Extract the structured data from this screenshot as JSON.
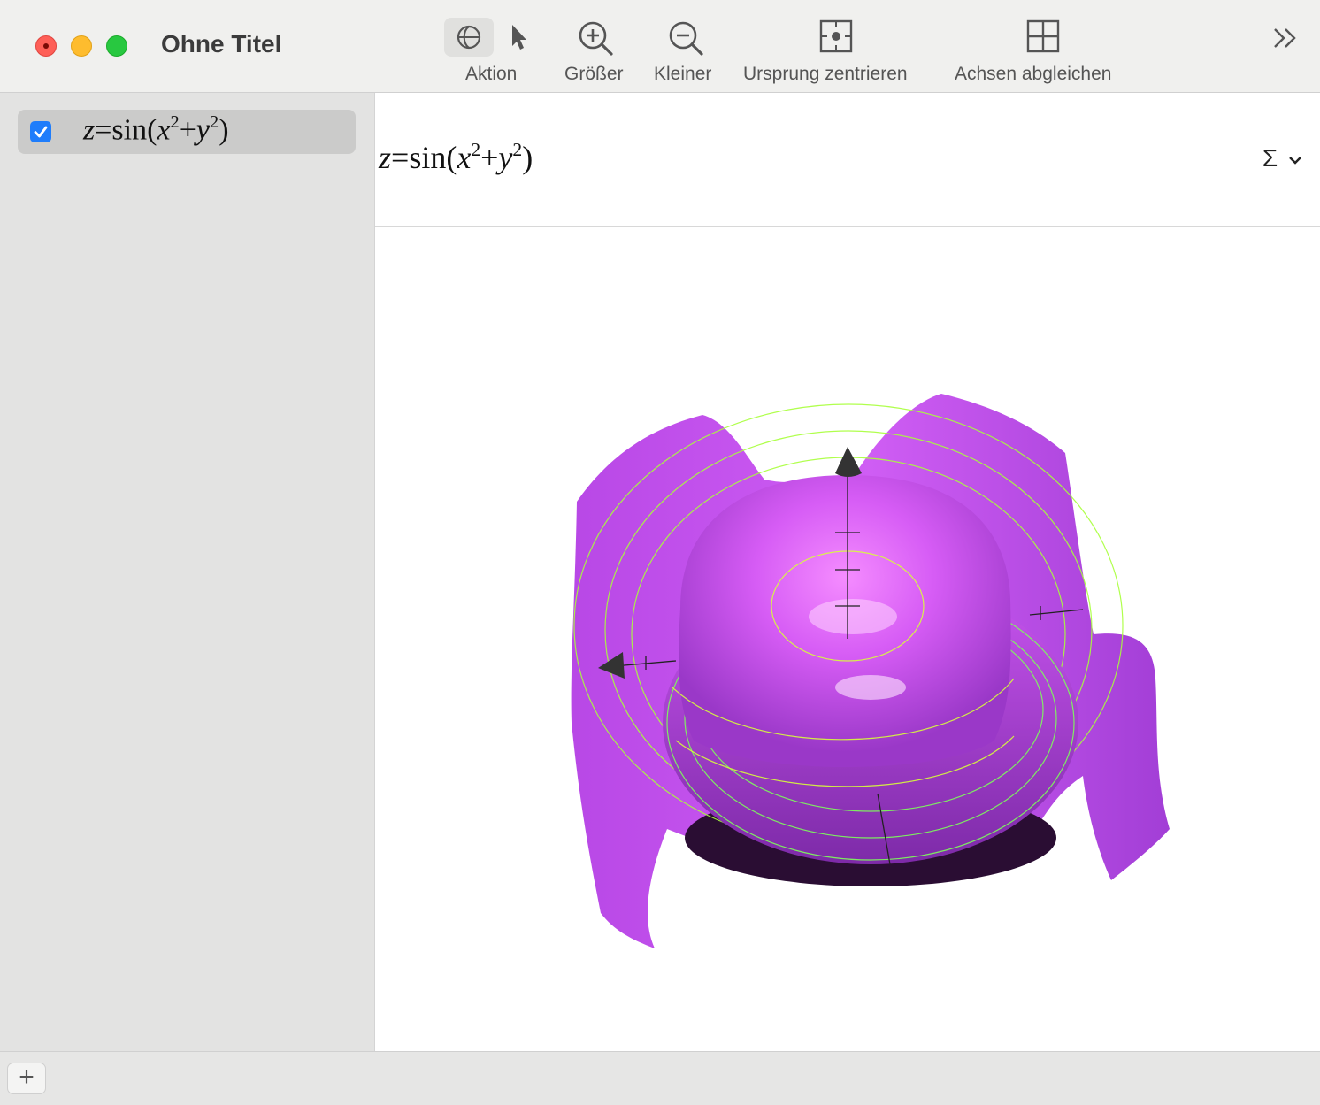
{
  "window": {
    "title": "Ohne Titel"
  },
  "toolbar": {
    "action_label": "Aktion",
    "zoom_in_label": "Größer",
    "zoom_out_label": "Kleiner",
    "center_origin_label": "Ursprung zentrieren",
    "equalize_axes_label": "Achsen abgleichen",
    "overflow_icon": "double-chevron-right-icon",
    "action_mode_selected": "rotate"
  },
  "sidebar": {
    "items": [
      {
        "checked": true,
        "z": "z",
        "eq": "=sin(",
        "x": "x",
        "sq1": "2",
        "plus": "+",
        "y": "y",
        "sq2": "2",
        "close": ")"
      }
    ]
  },
  "editor": {
    "formula": {
      "z": "z",
      "eq": "=sin(",
      "x": "x",
      "sq1": "2",
      "plus": "+",
      "y": "y",
      "sq2": "2",
      "close": ")"
    },
    "sigma_symbol": "Σ"
  },
  "bottombar": {
    "add_symbol": "+"
  },
  "colors": {
    "surface": "#c44cf0",
    "contour": "#a8ff3a",
    "accent": "#1f7dfb"
  }
}
